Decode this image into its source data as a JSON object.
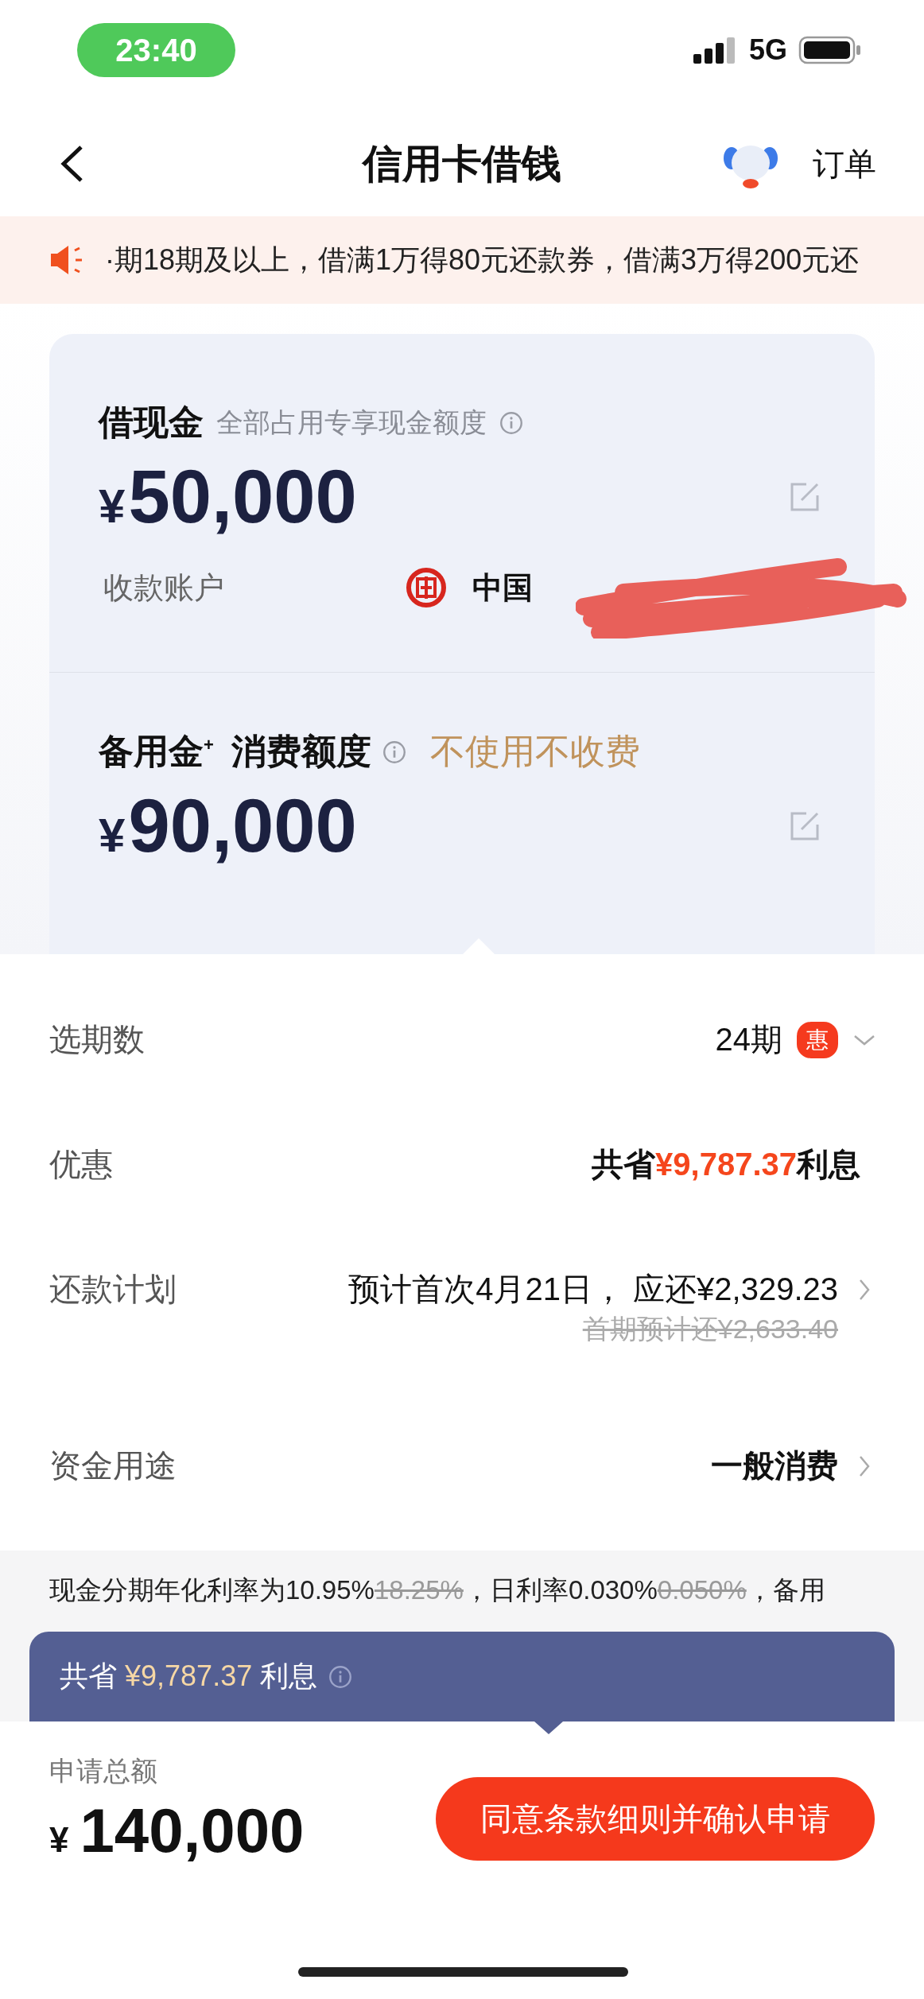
{
  "status_bar": {
    "time": "23:40",
    "network": "5G"
  },
  "nav": {
    "title": "信用卡借钱",
    "right_link": "订单"
  },
  "notice": {
    "text": "·期18期及以上，借满1万得80元还款券，借满3万得200元还"
  },
  "card": {
    "cash": {
      "title": "借现金",
      "subtitle": "全部占用专享现金额度",
      "currency": "¥",
      "amount": "50,000"
    },
    "account": {
      "label": "收款账户",
      "bank_prefix": "中国"
    },
    "reserve": {
      "title": "备用金$^{+}$",
      "tag": "消费额度",
      "note": "不使用不收费",
      "currency": "¥",
      "amount": "90,000"
    }
  },
  "rows": [
    {
      "kind": "select",
      "label": "选期数",
      "value": "24期",
      "badge": "惠"
    },
    {
      "kind": "savings",
      "label": "优惠",
      "prefix": "共省",
      "highlight": "¥9,787.37",
      "suffix": "利息"
    },
    {
      "kind": "plan",
      "label": "还款计划",
      "value": "预计首次4月21日， 应还¥2,329.23",
      "old_value": "首期预计还¥2,633.40"
    },
    {
      "kind": "link",
      "label": "资金用途",
      "value": "一般消费"
    }
  ],
  "rate_text": [
    {
      "text": "现金分期年化利率为10.95%",
      "struck": false
    },
    {
      "text": "18.25%",
      "struck": true
    },
    {
      "text": "，日利率0.030%",
      "struck": false
    },
    {
      "text": "0.050%",
      "struck": true
    },
    {
      "text": "，备用",
      "struck": false
    }
  ],
  "banner": {
    "prefix": "共省",
    "amount": "¥9,787.37",
    "suffix": "利息"
  },
  "footer": {
    "label": "申请总额",
    "currency": "¥",
    "amount": "140,000",
    "button": "同意条款细则并确认申请"
  }
}
